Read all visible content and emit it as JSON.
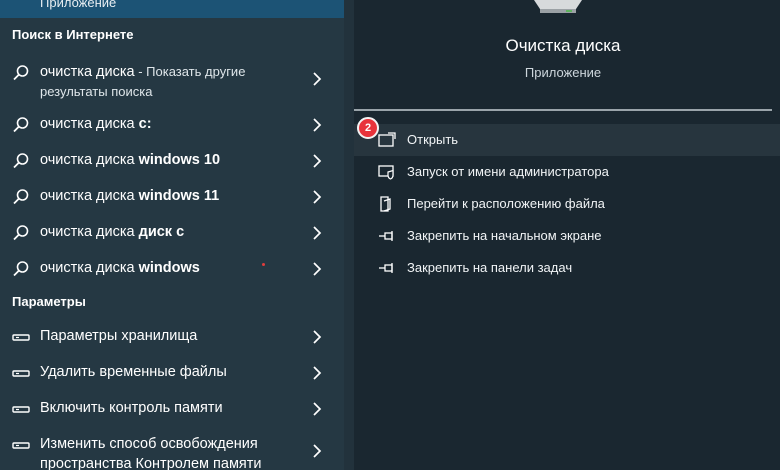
{
  "top_item": {
    "subtitle": "Приложение"
  },
  "web_section": {
    "title": "Поиск в Интернете",
    "items": [
      {
        "query": "очистка диска",
        "bold": "",
        "hint": " - Показать другие",
        "hint2": "результаты поиска"
      },
      {
        "query": "очистка диска ",
        "bold": "c:"
      },
      {
        "query": "очистка диска ",
        "bold": "windows 10"
      },
      {
        "query": "очистка диска ",
        "bold": "windows 11"
      },
      {
        "query": "очистка диска ",
        "bold": "диск с"
      },
      {
        "query": "очистка диска ",
        "bold": "windows"
      }
    ]
  },
  "settings_section": {
    "title": "Параметры",
    "items": [
      {
        "label": "Параметры хранилища"
      },
      {
        "label": "Удалить временные файлы"
      },
      {
        "label": "Включить контроль памяти"
      },
      {
        "label": "Изменить способ освобождения пространства Контролем памяти"
      }
    ]
  },
  "details": {
    "app_name": "Очистка диска",
    "app_type": "Приложение",
    "actions": [
      {
        "label": "Открыть",
        "icon": "open-icon"
      },
      {
        "label": "Запуск от имени администратора",
        "icon": "shield-icon"
      },
      {
        "label": "Перейти к расположению файла",
        "icon": "file-location-icon"
      },
      {
        "label": "Закрепить на начальном экране",
        "icon": "pin-icon"
      },
      {
        "label": "Закрепить на панели задач",
        "icon": "pin-icon"
      }
    ],
    "badge": "2"
  },
  "colors": {
    "left_panel": "#253843",
    "right_panel": "#1a2730",
    "selected": "#1c5375",
    "badge": "#e8333b"
  }
}
